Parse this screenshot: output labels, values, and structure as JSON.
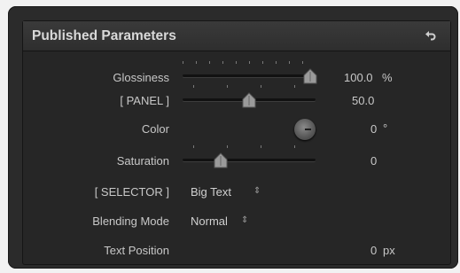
{
  "header": {
    "title": "Published Parameters",
    "reset_icon": "undo-arrow-icon"
  },
  "rows": {
    "glossiness": {
      "label": "Glossiness",
      "value": "100.0",
      "unit": "%",
      "level": 1.0
    },
    "panel": {
      "label": "[ PANEL ]",
      "value": "50.0",
      "level": 0.5
    },
    "color": {
      "label": "Color",
      "value": "0",
      "unit": "°"
    },
    "saturation": {
      "label": "Saturation",
      "value": "0",
      "level": 0.27
    },
    "selector": {
      "label": "[ SELECTOR ]",
      "value": "Big Text",
      "arrows": "⇕"
    },
    "blending": {
      "label": "Blending Mode",
      "value": "Normal",
      "arrows": "⇕"
    },
    "text_position": {
      "label": "Text Position",
      "value": "0",
      "unit": "px"
    }
  },
  "colors": {
    "background": "#262626",
    "text": "#c8c8c8",
    "header": "#333333"
  }
}
